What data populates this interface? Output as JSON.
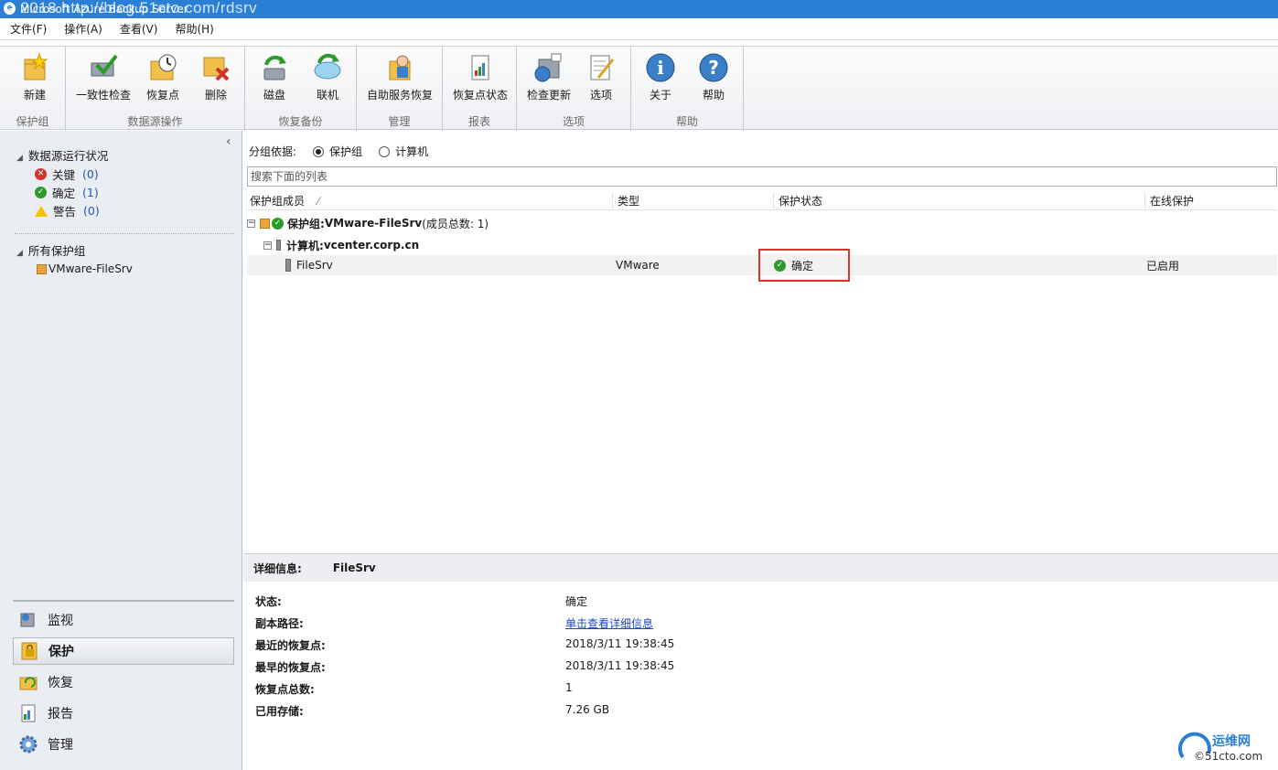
{
  "window": {
    "title": "Microsoft Azure Backup Server",
    "watermark": "© 2018 http://blog.51cto.com/rdsrv"
  },
  "menu": [
    "文件(F)",
    "操作(A)",
    "查看(V)",
    "帮助(H)"
  ],
  "ribbon": {
    "groups": [
      {
        "name": "保护组",
        "buttons": [
          {
            "label": "新建",
            "icon": "new-folder-icon"
          }
        ]
      },
      {
        "name": "数据源操作",
        "buttons": [
          {
            "label": "一致性检查",
            "icon": "consistency-check-icon"
          },
          {
            "label": "恢复点",
            "icon": "recovery-point-icon"
          },
          {
            "label": "删除",
            "icon": "delete-icon"
          }
        ]
      },
      {
        "name": "恢复备份",
        "buttons": [
          {
            "label": "磁盘",
            "icon": "disk-icon"
          },
          {
            "label": "联机",
            "icon": "online-icon"
          }
        ]
      },
      {
        "name": "管理",
        "buttons": [
          {
            "label": "自助服务恢复",
            "icon": "self-service-icon"
          }
        ]
      },
      {
        "name": "报表",
        "buttons": [
          {
            "label": "恢复点状态",
            "icon": "report-icon"
          }
        ]
      },
      {
        "name": "选项",
        "buttons": [
          {
            "label": "检查更新",
            "icon": "update-icon"
          },
          {
            "label": "选项",
            "icon": "options-icon"
          }
        ]
      },
      {
        "name": "帮助",
        "buttons": [
          {
            "label": "关于",
            "icon": "info-icon"
          },
          {
            "label": "帮助",
            "icon": "help-icon"
          }
        ]
      }
    ]
  },
  "leftpane": {
    "health_title": "数据源运行状况",
    "health": [
      {
        "label": "关键",
        "count": "(0)",
        "color": "#d6312a"
      },
      {
        "label": "确定",
        "count": "(1)",
        "color": "#2b9a2b"
      },
      {
        "label": "警告",
        "count": "(0)",
        "color": "#f2c200"
      }
    ],
    "groups_title": "所有保护组",
    "groups": [
      "VMware-FileSrv"
    ],
    "nav": [
      {
        "label": "监视",
        "selected": false
      },
      {
        "label": "保护",
        "selected": true
      },
      {
        "label": "恢复",
        "selected": false
      },
      {
        "label": "报告",
        "selected": false
      },
      {
        "label": "管理",
        "selected": false
      }
    ]
  },
  "main": {
    "group_by_label": "分组依据:",
    "group_by_options": [
      "保护组",
      "计算机"
    ],
    "group_by_selected": "保护组",
    "search_placeholder": "搜索下面的列表",
    "columns": [
      "保护组成员",
      "类型",
      "保护状态",
      "在线保护"
    ],
    "group_row": {
      "prefix": "保护组: ",
      "name": "VMware-FileSrv",
      "suffix": " (成员总数: 1)"
    },
    "computer_row": {
      "prefix": "计算机: ",
      "name": "vcenter.corp.cn"
    },
    "member": {
      "name": "FileSrv",
      "type": "VMware",
      "status": "确定",
      "online": "已启用"
    }
  },
  "details": {
    "label": "详细信息:",
    "name": "FileSrv",
    "rows": [
      {
        "key": "状态:",
        "value": "确定"
      },
      {
        "key": "副本路径:",
        "value": "单击查看详细信息",
        "link": true
      },
      {
        "key": "最近的恢复点:",
        "value": "2018/3/11 19:38:45"
      },
      {
        "key": "最早的恢复点:",
        "value": "2018/3/11 19:38:45"
      },
      {
        "key": "恢复点总数:",
        "value": "1"
      },
      {
        "key": "已用存储:",
        "value": "7.26 GB"
      }
    ]
  },
  "site_logo": {
    "text1": "运维网",
    "text2": "©51cto.com"
  }
}
